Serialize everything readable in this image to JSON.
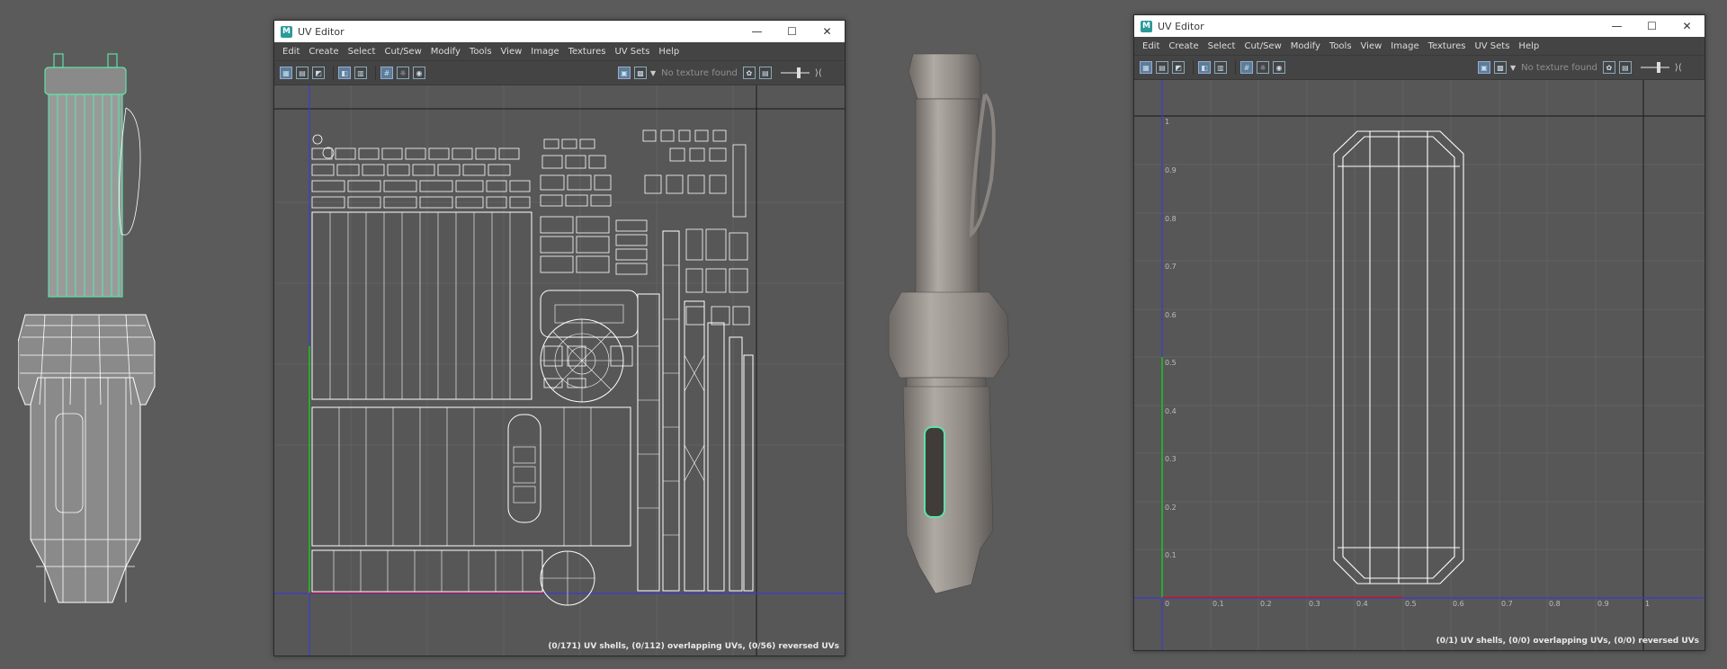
{
  "windows": [
    {
      "title": "UV Editor",
      "menu": [
        "Edit",
        "Create",
        "Select",
        "Cut/Sew",
        "Modify",
        "Tools",
        "View",
        "Image",
        "Textures",
        "UV Sets",
        "Help"
      ],
      "no_texture_label": "No texture found",
      "status": "(0/171) UV shells, (0/112) overlapping UVs, (0/56) reversed UVs"
    },
    {
      "title": "UV Editor",
      "menu": [
        "Edit",
        "Create",
        "Select",
        "Cut/Sew",
        "Modify",
        "Tools",
        "View",
        "Image",
        "Textures",
        "UV Sets",
        "Help"
      ],
      "no_texture_label": "No texture found",
      "status": "(0/1) UV shells, (0/0) overlapping UVs, (0/0) reversed UVs",
      "u_ticks": [
        "0",
        "0.1",
        "0.2",
        "0.3",
        "0.4",
        "0.5",
        "0.6",
        "0.7",
        "0.8",
        "0.9",
        "1"
      ],
      "v_ticks": [
        "0.1",
        "0.2",
        "0.3",
        "0.4",
        "0.5",
        "0.6",
        "0.7",
        "0.8",
        "0.9",
        "1"
      ]
    }
  ],
  "title_controls": {
    "minimize": "—",
    "maximize": "☐",
    "close": "✕"
  },
  "colors": {
    "selection_green": "#5fe0a8",
    "axis_blue": "#3b3bd0",
    "axis_red": "#c02020",
    "axis_green": "#20c020",
    "wire_white": "#ffffff"
  }
}
